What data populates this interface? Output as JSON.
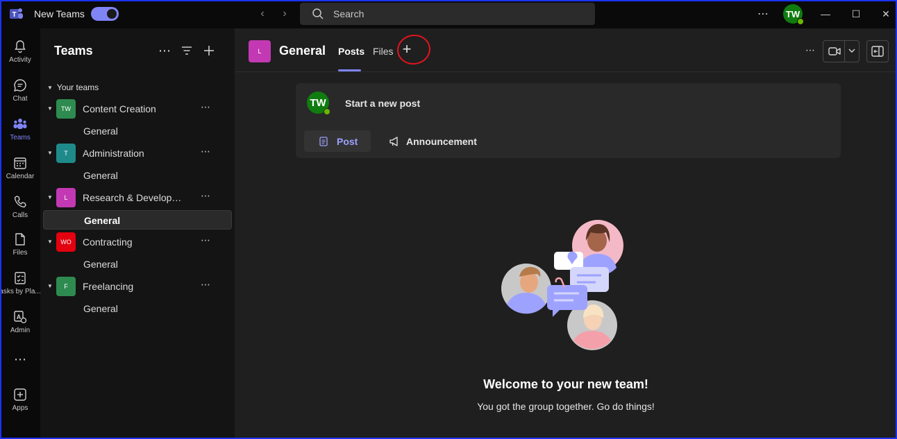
{
  "titlebar": {
    "app_name": "New Teams",
    "search_placeholder": "Search",
    "user_initials": "TW"
  },
  "rail": {
    "items": [
      {
        "label": "Activity",
        "icon": "bell-icon"
      },
      {
        "label": "Chat",
        "icon": "chat-icon"
      },
      {
        "label": "Teams",
        "icon": "teams-icon",
        "active": true
      },
      {
        "label": "Calendar",
        "icon": "calendar-icon"
      },
      {
        "label": "Calls",
        "icon": "phone-icon"
      },
      {
        "label": "Files",
        "icon": "file-icon"
      },
      {
        "label": "asks by Pla...",
        "icon": "planner-icon"
      },
      {
        "label": "Admin",
        "icon": "admin-icon"
      },
      {
        "label": "Apps",
        "icon": "add-app-icon"
      }
    ]
  },
  "teams_panel": {
    "title": "Teams",
    "section_label": "Your teams",
    "teams": [
      {
        "name": "Content Creation",
        "initials": "TW",
        "color": "#2e8b4f",
        "channel": "General"
      },
      {
        "name": "Administration",
        "initials": "T",
        "color": "#1f8a8a",
        "channel": "General"
      },
      {
        "name": "Research & Development",
        "initials": "L",
        "color": "#c239b3",
        "channel": "General",
        "selected": true
      },
      {
        "name": "Contracting",
        "initials": "WO",
        "color": "#e3000f",
        "channel": "General"
      },
      {
        "name": "Freelancing",
        "initials": "F",
        "color": "#2e8b4f",
        "channel": "General"
      }
    ]
  },
  "channel": {
    "avatar_initials": "L",
    "title": "General",
    "tabs": [
      "Posts",
      "Files"
    ],
    "active_tab": "Posts"
  },
  "composer": {
    "placeholder": "Start a new post",
    "post_label": "Post",
    "announcement_label": "Announcement",
    "user_initials": "TW"
  },
  "empty_state": {
    "title": "Welcome to your new team!",
    "subtitle": "You got the group together. Go do things!"
  },
  "colors": {
    "accent": "#7f85f5",
    "presence": "#6bb700",
    "annotation": "#e0141e"
  }
}
